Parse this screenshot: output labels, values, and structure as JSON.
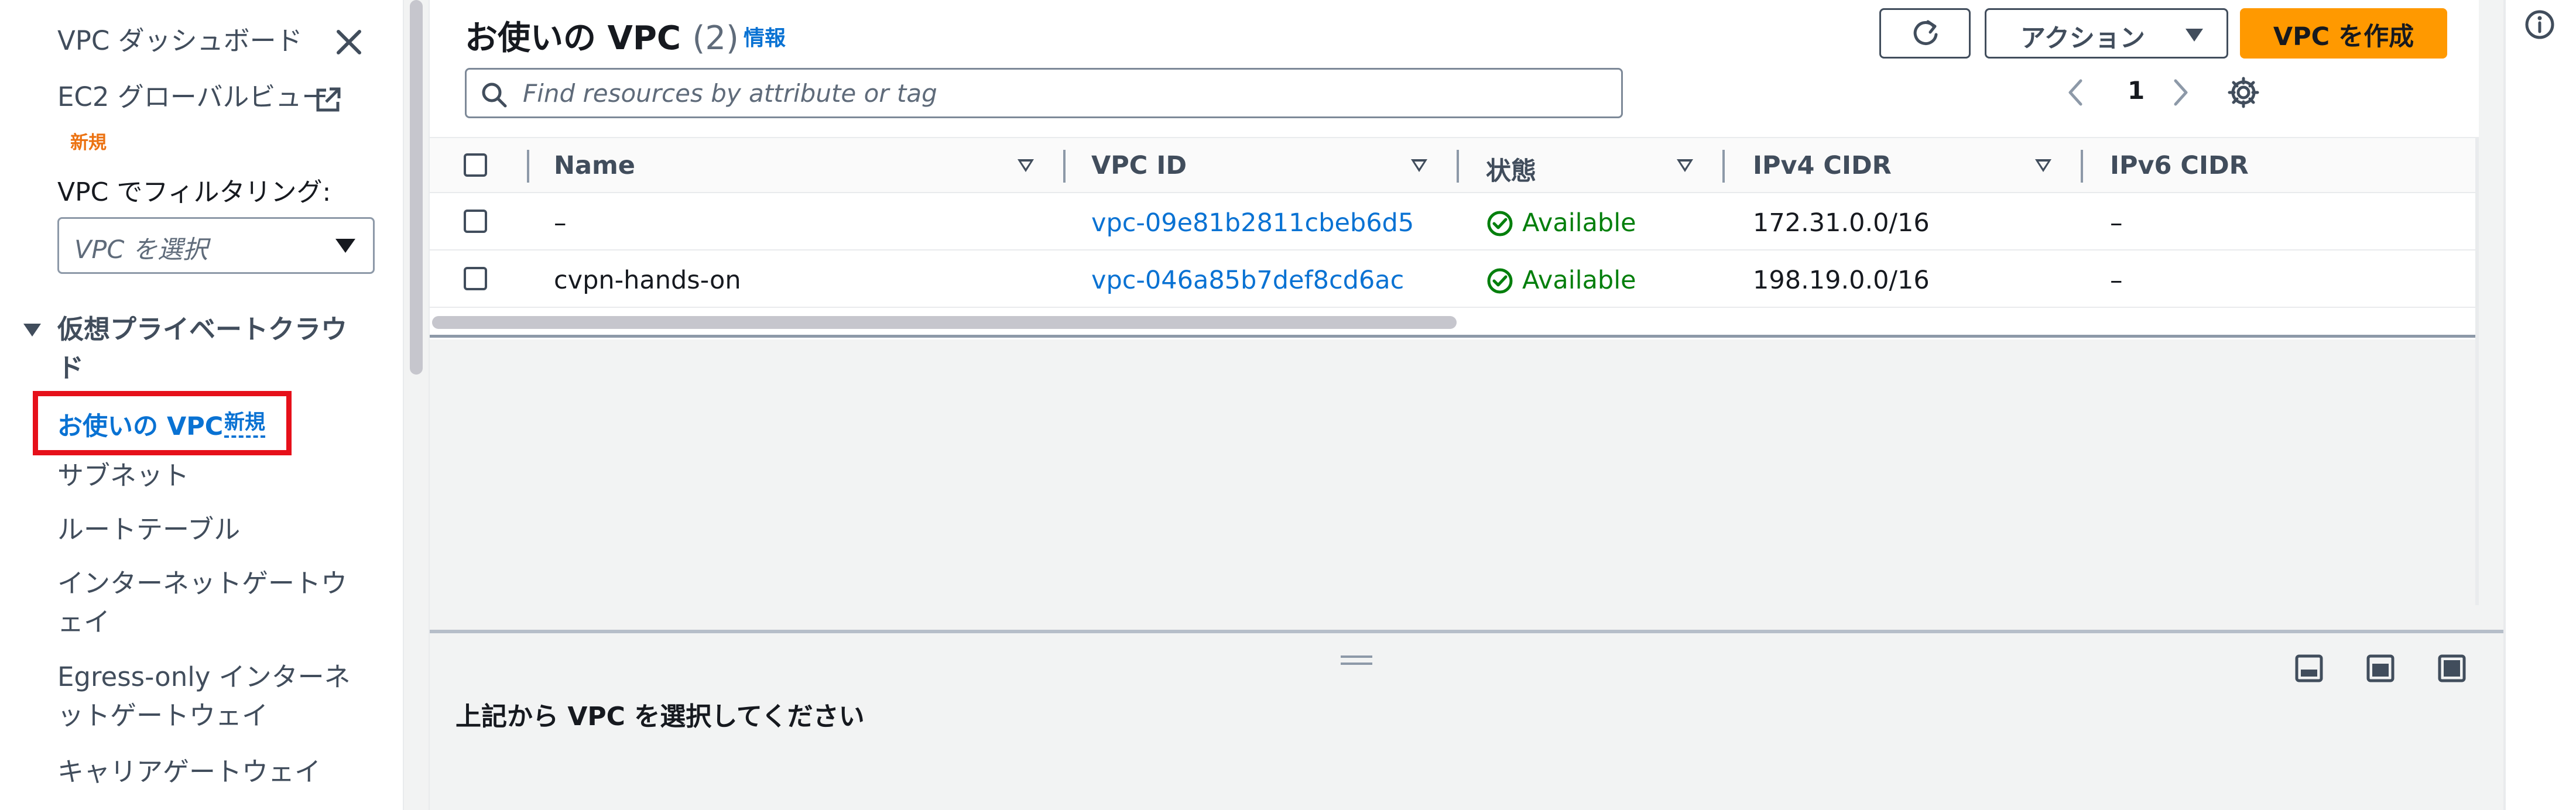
{
  "sidebar": {
    "dashboard": "VPC ダッシュボード",
    "ec2_global_view": "EC2 グローバルビュー",
    "new_badge": "新規",
    "filter_label": "VPC でフィルタリング:",
    "filter_placeholder": "VPC を選択",
    "section_title": "仮想プライベートクラウド",
    "active_item": "お使いの VPC",
    "active_item_badge": "新規",
    "items": [
      {
        "label": "サブネット"
      },
      {
        "label": "ルートテーブル"
      },
      {
        "label": "インターネットゲートウェイ"
      },
      {
        "label": "Egress-only インターネットゲートウェイ"
      },
      {
        "label": "キャリアゲートウェイ"
      }
    ]
  },
  "header": {
    "title": "お使いの VPC",
    "count": "(2)",
    "info_link": "情報",
    "actions_label": "アクション",
    "create_label": "VPC を作成"
  },
  "search": {
    "placeholder": "Find resources by attribute or tag"
  },
  "pagination": {
    "current_page": "1"
  },
  "table": {
    "columns": [
      "Name",
      "VPC ID",
      "状態",
      "IPv4 CIDR",
      "IPv6 CIDR"
    ],
    "rows": [
      {
        "name": "–",
        "vpc_id": "vpc-09e81b2811cbeb6d5",
        "state": "Available",
        "ipv4": "172.31.0.0/16",
        "ipv6": "–"
      },
      {
        "name": "cvpn-hands-on",
        "vpc_id": "vpc-046a85b7def8cd6ac",
        "state": "Available",
        "ipv4": "198.19.0.0/16",
        "ipv6": "–"
      }
    ]
  },
  "split_panel": {
    "message": "上記から VPC を選択してください"
  },
  "colors": {
    "link": "#0972d3",
    "primary_button": "#ff9900",
    "status_available": "#037f0c",
    "highlight_box": "#e6101a",
    "new_badge": "#ec7211"
  },
  "icons": [
    "close-icon",
    "external-link-icon",
    "caret-down-icon",
    "refresh-icon",
    "search-icon",
    "chevron-left-icon",
    "chevron-right-icon",
    "settings-icon",
    "sort-icon",
    "status-available-icon",
    "panel-bottom-icon",
    "panel-side-icon",
    "panel-full-icon",
    "info-icon"
  ]
}
